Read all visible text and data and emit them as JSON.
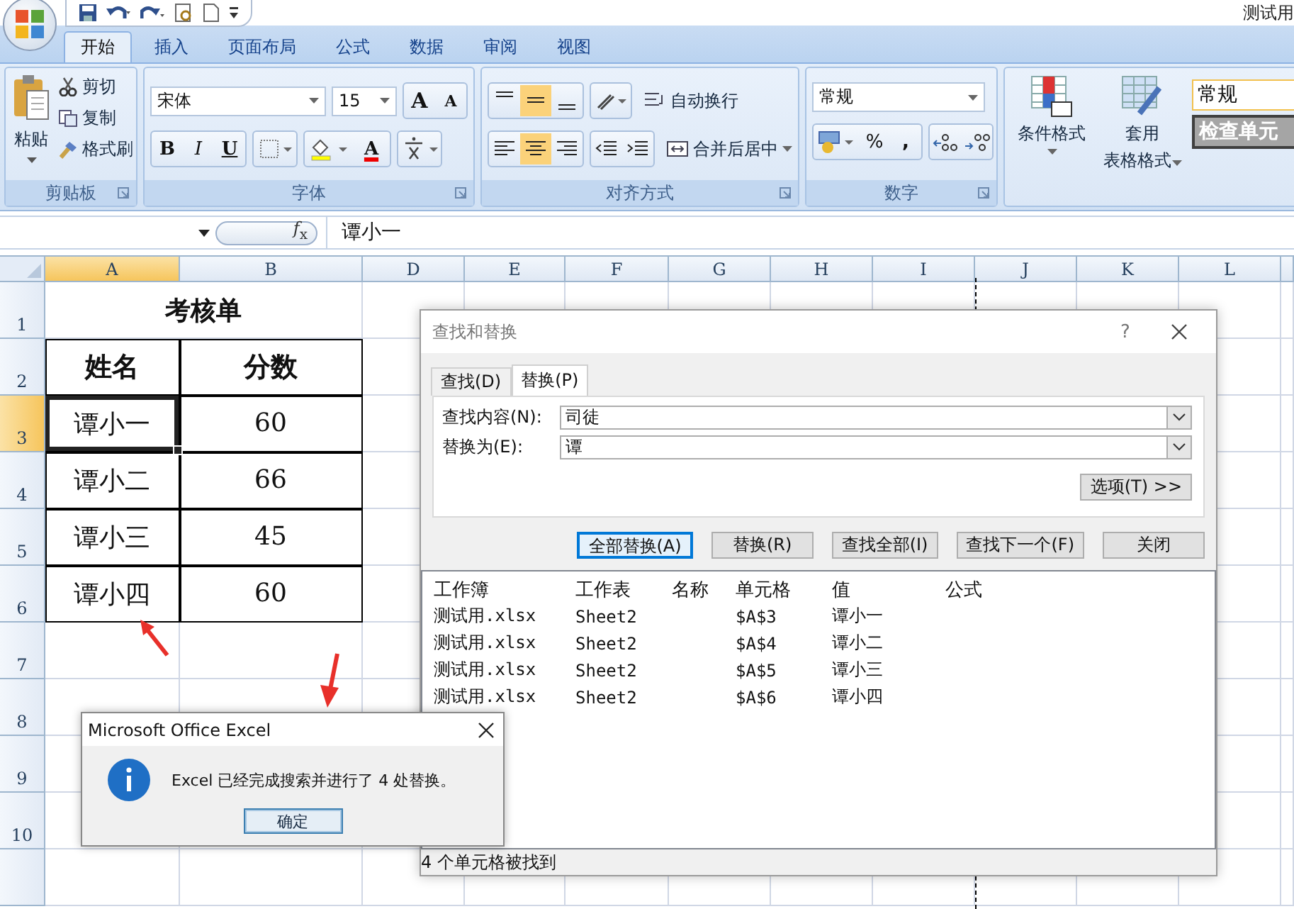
{
  "app_title": "测试用",
  "ribbon": {
    "tabs": [
      {
        "label": "开始",
        "selected": true
      },
      {
        "label": "插入",
        "selected": false
      },
      {
        "label": "页面布局",
        "selected": false
      },
      {
        "label": "公式",
        "selected": false
      },
      {
        "label": "数据",
        "selected": false
      },
      {
        "label": "审阅",
        "selected": false
      },
      {
        "label": "视图",
        "selected": false
      }
    ],
    "clipboard": {
      "label": "剪贴板",
      "paste": "粘贴",
      "cut": "剪切",
      "copy": "复制",
      "format_painter": "格式刷"
    },
    "font": {
      "label": "字体",
      "name": "宋体",
      "size": "15",
      "grow": "A",
      "shrink": "A",
      "bold": "B",
      "italic": "I",
      "underline": "U",
      "font_color_label": "A"
    },
    "alignment": {
      "label": "对齐方式",
      "vertical": [
        {
          "kind": "top",
          "selected": false
        },
        {
          "kind": "middle",
          "selected": true
        },
        {
          "kind": "bottom",
          "selected": false
        }
      ],
      "horizontal": [
        {
          "kind": "left",
          "selected": false
        },
        {
          "kind": "center",
          "selected": true
        },
        {
          "kind": "right",
          "selected": false
        }
      ],
      "wrap": "自动换行",
      "merge": "合并后居中"
    },
    "number": {
      "label": "数字",
      "format": "常规",
      "percent": "%",
      "comma": ","
    },
    "styles": {
      "conditional": "条件格式",
      "table_format": [
        "套用",
        "表格格式"
      ],
      "normal": "常规",
      "check": "检查单元"
    }
  },
  "formula_bar": {
    "fx": "*f*$_{x}$",
    "value": "谭小一"
  },
  "sheet": {
    "columns": [
      {
        "label": "A",
        "selected": true
      },
      {
        "label": "B",
        "selected": false
      },
      {
        "label": "D",
        "selected": false
      },
      {
        "label": "E",
        "selected": false
      },
      {
        "label": "F",
        "selected": false
      },
      {
        "label": "G",
        "selected": false
      },
      {
        "label": "H",
        "selected": false
      },
      {
        "label": "I",
        "selected": false
      },
      {
        "label": "J",
        "selected": false
      },
      {
        "label": "K",
        "selected": false
      },
      {
        "label": "L",
        "selected": false
      }
    ],
    "rows": [
      {
        "number": "1",
        "selected": false,
        "kind": "title",
        "cells": [
          {
            "text": "考核单"
          }
        ]
      },
      {
        "number": "2",
        "selected": false,
        "kind": "header",
        "cells": [
          {
            "text": "姓名"
          },
          {
            "text": "分数"
          }
        ]
      },
      {
        "number": "3",
        "selected": true,
        "kind": "data",
        "cells": [
          {
            "text": "谭小一",
            "selected": true
          },
          {
            "text": "60",
            "selected": false
          }
        ]
      },
      {
        "number": "4",
        "selected": false,
        "kind": "data",
        "cells": [
          {
            "text": "谭小二",
            "selected": false
          },
          {
            "text": "66",
            "selected": false
          }
        ]
      },
      {
        "number": "5",
        "selected": false,
        "kind": "data",
        "cells": [
          {
            "text": "谭小三",
            "selected": false
          },
          {
            "text": "45",
            "selected": false
          }
        ]
      },
      {
        "number": "6",
        "selected": false,
        "kind": "data",
        "cells": [
          {
            "text": "谭小四",
            "selected": false
          },
          {
            "text": "60",
            "selected": false
          }
        ]
      },
      {
        "number": "7",
        "selected": false,
        "kind": "empty"
      },
      {
        "number": "8",
        "selected": false,
        "kind": "empty"
      },
      {
        "number": "9",
        "selected": false,
        "kind": "empty"
      },
      {
        "number": "10",
        "selected": false,
        "kind": "empty"
      }
    ]
  },
  "find_dialog": {
    "title": "查找和替换",
    "help": "?",
    "tabs": [
      {
        "label": "查找(D)",
        "selected": false
      },
      {
        "label": "替换(P)",
        "selected": true
      }
    ],
    "fields": [
      {
        "label": "查找内容(N):",
        "value": "司徒"
      },
      {
        "label": "替换为(E):",
        "value": "谭"
      }
    ],
    "options": "选项(T) >>",
    "buttons": [
      {
        "label": "全部替换(A)",
        "selected": true
      },
      {
        "label": "替换(R)",
        "selected": false
      },
      {
        "label": "查找全部(I)",
        "selected": false
      },
      {
        "label": "查找下一个(F)",
        "selected": false
      },
      {
        "label": "关闭",
        "selected": false
      }
    ],
    "columns": [
      "工作簿",
      "工作表",
      "名称",
      "单元格",
      "值",
      "公式"
    ],
    "results": [
      {
        "workbook": "测试用.xlsx",
        "sheet": "Sheet2",
        "cell": "$A$3",
        "value": "谭小一"
      },
      {
        "workbook": "测试用.xlsx",
        "sheet": "Sheet2",
        "cell": "$A$4",
        "value": "谭小二"
      },
      {
        "workbook": "测试用.xlsx",
        "sheet": "Sheet2",
        "cell": "$A$5",
        "value": "谭小三"
      },
      {
        "workbook": "测试用.xlsx",
        "sheet": "Sheet2",
        "cell": "$A$6",
        "value": "谭小四"
      }
    ],
    "status": "4 个单元格被找到"
  },
  "message_box": {
    "title": "Microsoft Office Excel",
    "message": "Excel 已经完成搜索并进行了 4 处替换。",
    "button": "确定"
  }
}
